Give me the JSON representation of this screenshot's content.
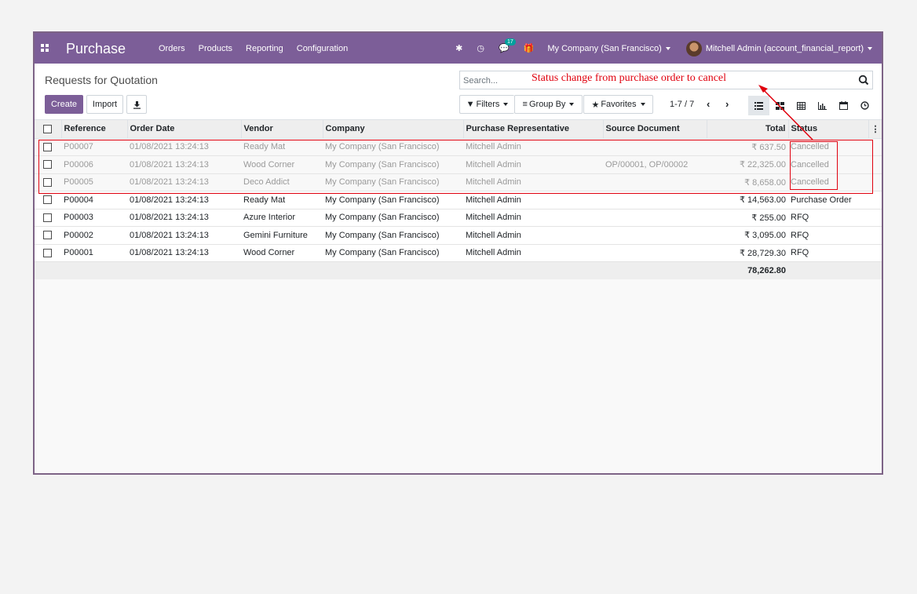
{
  "navbar": {
    "brand": "Purchase",
    "menu": [
      "Orders",
      "Products",
      "Reporting",
      "Configuration"
    ],
    "messages_badge": "17",
    "company": "My Company (San Francisco)",
    "user": "Mitchell Admin (account_financial_report)"
  },
  "control_panel": {
    "title": "Requests for Quotation",
    "create_label": "Create",
    "import_label": "Import",
    "search_placeholder": "Search...",
    "filters_label": "Filters",
    "groupby_label": "Group By",
    "favorites_label": "Favorites",
    "pager": "1-7 / 7"
  },
  "table": {
    "columns": [
      "Reference",
      "Order Date",
      "Vendor",
      "Company",
      "Purchase Representative",
      "Source Document",
      "Total",
      "Status"
    ],
    "rows": [
      {
        "ref": "P00007",
        "date": "01/08/2021 13:24:13",
        "vendor": "Ready Mat",
        "company": "My Company (San Francisco)",
        "rep": "Mitchell Admin",
        "source": "",
        "total": "₹ 637.50",
        "status": "Cancelled",
        "cancelled": true
      },
      {
        "ref": "P00006",
        "date": "01/08/2021 13:24:13",
        "vendor": "Wood Corner",
        "company": "My Company (San Francisco)",
        "rep": "Mitchell Admin",
        "source": "OP/00001, OP/00002",
        "total": "₹ 22,325.00",
        "status": "Cancelled",
        "cancelled": true
      },
      {
        "ref": "P00005",
        "date": "01/08/2021 13:24:13",
        "vendor": "Deco Addict",
        "company": "My Company (San Francisco)",
        "rep": "Mitchell Admin",
        "source": "",
        "total": "₹ 8,658.00",
        "status": "Cancelled",
        "cancelled": true
      },
      {
        "ref": "P00004",
        "date": "01/08/2021 13:24:13",
        "vendor": "Ready Mat",
        "company": "My Company (San Francisco)",
        "rep": "Mitchell Admin",
        "source": "",
        "total": "₹ 14,563.00",
        "status": "Purchase Order",
        "cancelled": false
      },
      {
        "ref": "P00003",
        "date": "01/08/2021 13:24:13",
        "vendor": "Azure Interior",
        "company": "My Company (San Francisco)",
        "rep": "Mitchell Admin",
        "source": "",
        "total": "₹ 255.00",
        "status": "RFQ",
        "cancelled": false
      },
      {
        "ref": "P00002",
        "date": "01/08/2021 13:24:13",
        "vendor": "Gemini Furniture",
        "company": "My Company (San Francisco)",
        "rep": "Mitchell Admin",
        "source": "",
        "total": "₹ 3,095.00",
        "status": "RFQ",
        "cancelled": false
      },
      {
        "ref": "P00001",
        "date": "01/08/2021 13:24:13",
        "vendor": "Wood Corner",
        "company": "My Company (San Francisco)",
        "rep": "Mitchell Admin",
        "source": "",
        "total": "₹ 28,729.30",
        "status": "RFQ",
        "cancelled": false
      }
    ],
    "grand_total": "78,262.80"
  },
  "annotation": {
    "text": "Status change from purchase order to cancel",
    "color": "#e0000e"
  },
  "colors": {
    "brand": "#7c5e98",
    "annotation": "#e0000e"
  }
}
